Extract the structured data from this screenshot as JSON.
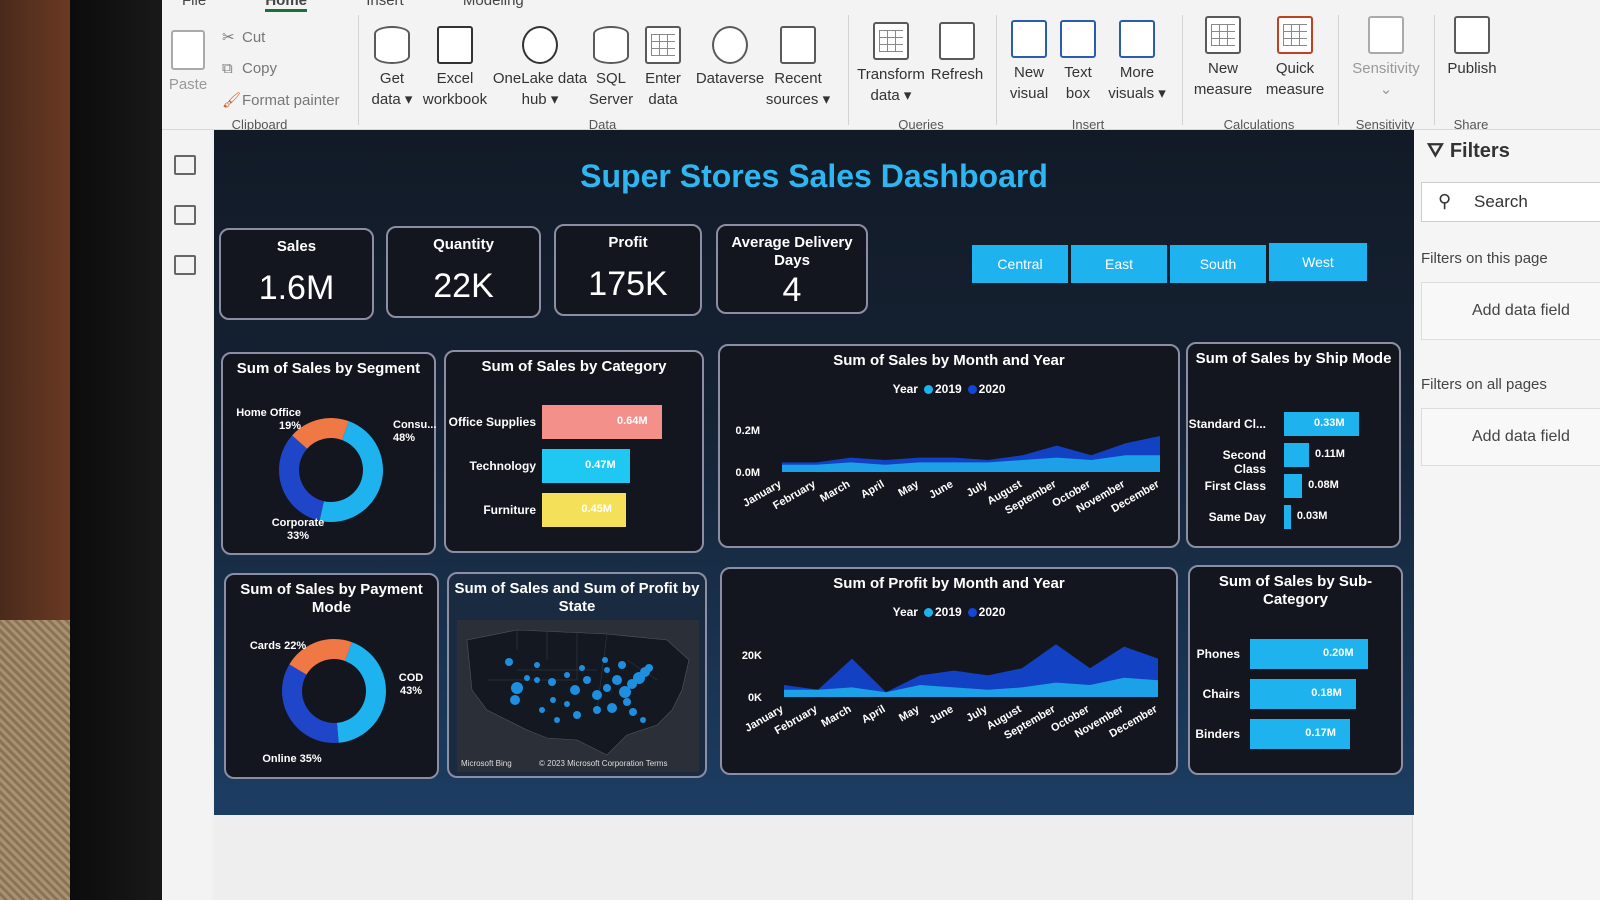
{
  "ribbon": {
    "tabs": [
      "File",
      "Home",
      "Insert",
      "Modeling"
    ],
    "clipboard": {
      "paste": "Paste",
      "cut": "Cut",
      "copy": "Copy",
      "format_painter": "Format painter",
      "label": "Clipboard"
    },
    "data": {
      "get_data": "Get data",
      "excel": "Excel workbook",
      "onelake": "OneLake data hub",
      "sql": "SQL Server",
      "enter": "Enter data",
      "dataverse": "Dataverse",
      "recent": "Recent sources",
      "label": "Data"
    },
    "queries": {
      "transform": "Transform data",
      "refresh": "Refresh",
      "label": "Queries"
    },
    "insert": {
      "new_visual": "New visual",
      "text_box": "Text box",
      "more_visuals": "More visuals",
      "label": "Insert"
    },
    "calculations": {
      "new_measure": "New measure",
      "quick_measure": "Quick measure",
      "label": "Calculations"
    },
    "sensitivity": {
      "btn": "Sensitivity",
      "label": "Sensitivity"
    },
    "share": {
      "publish": "Publish",
      "label": "Share"
    }
  },
  "filters": {
    "title": "Filters",
    "search_placeholder": "Search",
    "on_page": "Filters on this page",
    "add_field": "Add data field",
    "on_all": "Filters on all pages"
  },
  "dashboard": {
    "title": "Super Stores Sales Dashboard",
    "kpis": [
      {
        "label": "Sales",
        "value": "1.6M"
      },
      {
        "label": "Quantity",
        "value": "22K"
      },
      {
        "label": "Profit",
        "value": "175K"
      },
      {
        "label": "Average Delivery Days",
        "value": "4"
      }
    ],
    "regions": [
      "Central",
      "East",
      "South",
      "West"
    ],
    "legend_year": "Year",
    "legend_2019": "2019",
    "legend_2020": "2020",
    "map_footer_left": "Microsoft Bing",
    "map_footer_right": "© 2023 Microsoft Corporation  Terms"
  },
  "colors": {
    "accent": "#1eb3ef",
    "series_2019": "#1eb3ef",
    "series_2020": "#1246d6",
    "office": "#f4908a",
    "tech": "#1ec8f2",
    "furniture": "#f5e05a",
    "donut_orange": "#f07844",
    "donut_blue": "#1eb3ef",
    "donut_navy": "#1f46c9"
  },
  "chart_data": [
    {
      "type": "pie",
      "title": "Sum of Sales by Segment",
      "labels": [
        "Consu...",
        "Corporate",
        "Home Office"
      ],
      "pct_labels": [
        "48%",
        "33%",
        "19%"
      ],
      "values": [
        48,
        33,
        19
      ]
    },
    {
      "type": "bar",
      "title": "Sum of Sales by Category",
      "categories": [
        "Office Supplies",
        "Technology",
        "Furniture"
      ],
      "values": [
        0.64,
        0.47,
        0.45
      ],
      "value_labels": [
        "0.64M",
        "0.47M",
        "0.45M"
      ]
    },
    {
      "type": "area",
      "title": "Sum of Sales by Month and Year",
      "x": [
        "January",
        "February",
        "March",
        "April",
        "May",
        "June",
        "July",
        "August",
        "September",
        "October",
        "November",
        "December"
      ],
      "yticks": [
        "0.2M",
        "0.0M"
      ],
      "ylim": [
        0,
        0.25
      ],
      "series": [
        {
          "name": "2019",
          "values": [
            0.03,
            0.03,
            0.04,
            0.03,
            0.04,
            0.04,
            0.04,
            0.05,
            0.06,
            0.05,
            0.07,
            0.07
          ]
        },
        {
          "name": "2020",
          "values": [
            0.04,
            0.04,
            0.06,
            0.05,
            0.06,
            0.06,
            0.05,
            0.07,
            0.11,
            0.07,
            0.12,
            0.15
          ]
        }
      ]
    },
    {
      "type": "bar",
      "title": "Sum of Sales by Ship Mode",
      "categories": [
        "Standard Cl...",
        "Second Class",
        "First Class",
        "Same Day"
      ],
      "values": [
        0.33,
        0.11,
        0.08,
        0.03
      ],
      "value_labels": [
        "0.33M",
        "0.11M",
        "0.08M",
        "0.03M"
      ]
    },
    {
      "type": "pie",
      "title": "Sum of Sales by Payment Mode",
      "labels": [
        "COD",
        "Online",
        "Cards"
      ],
      "display_labels": [
        "COD\n43%",
        "Online 35%",
        "Cards 22%"
      ],
      "values": [
        43,
        35,
        22
      ]
    },
    {
      "type": "area",
      "title": "Sum of Profit by Month and Year",
      "x": [
        "January",
        "February",
        "March",
        "April",
        "May",
        "June",
        "July",
        "August",
        "September",
        "October",
        "November",
        "December"
      ],
      "yticks": [
        "20K",
        "0K"
      ],
      "ylim": [
        0,
        25
      ],
      "series": [
        {
          "name": "2019",
          "values": [
            3,
            3,
            4,
            2,
            5,
            4,
            3,
            4,
            6,
            5,
            8,
            7
          ]
        },
        {
          "name": "2020",
          "values": [
            5,
            3,
            16,
            2,
            9,
            11,
            9,
            12,
            22,
            12,
            21,
            16
          ]
        }
      ]
    },
    {
      "type": "bar",
      "title": "Sum of Sales by Sub-Category",
      "categories": [
        "Phones",
        "Chairs",
        "Binders"
      ],
      "values": [
        0.2,
        0.18,
        0.17
      ],
      "value_labels": [
        "0.20M",
        "0.18M",
        "0.17M"
      ]
    },
    {
      "type": "scatter",
      "title": "Sum of Sales and Sum of Profit by State"
    }
  ]
}
